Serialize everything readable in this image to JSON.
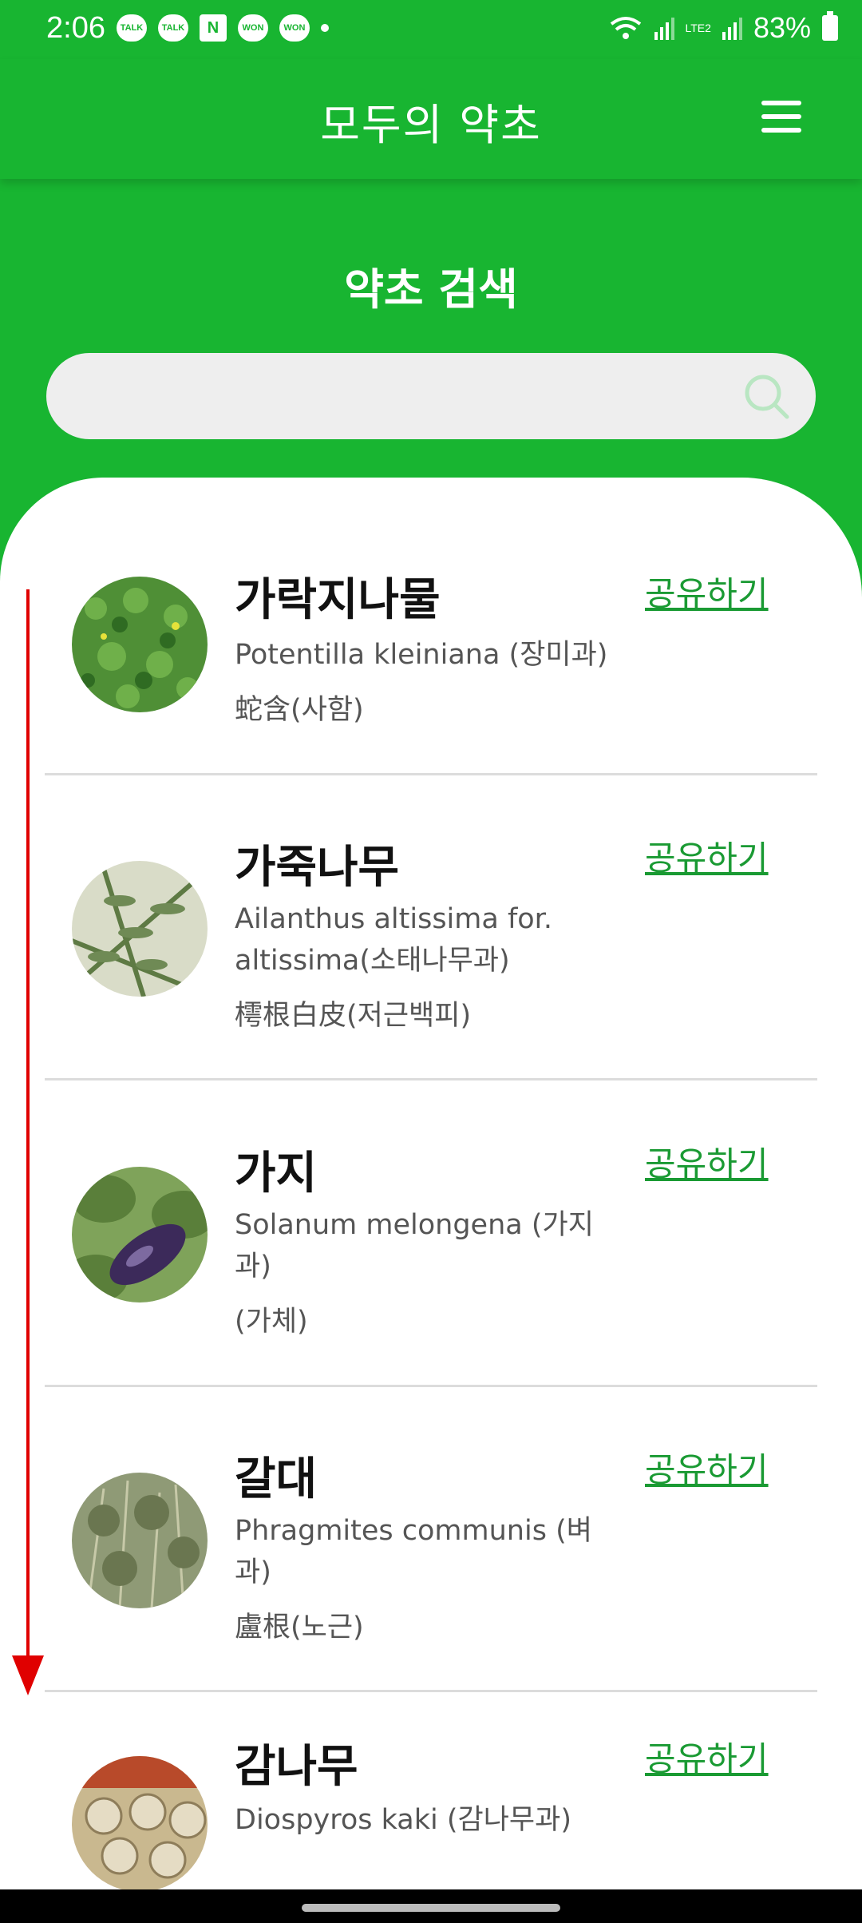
{
  "status": {
    "time": "2:06",
    "notifications": [
      "TALK",
      "TALK",
      "N",
      "WON",
      "WON"
    ],
    "battery": "83%",
    "network": "LTE2"
  },
  "appbar": {
    "title": "모두의 약초",
    "menu_icon": "hamburger-menu-icon"
  },
  "search": {
    "title": "약초 검색",
    "placeholder": "",
    "value": "",
    "icon": "search-icon"
  },
  "items": [
    {
      "name": "가락지나물",
      "scientific": "Potentilla kleiniana (장미과)",
      "herbal": "蛇含(사함)",
      "share": "공유하기",
      "thumb_color": "#4f8f36"
    },
    {
      "name": "가죽나무",
      "scientific": "Ailanthus altissima for. altissima(소태나무과)",
      "herbal": "樗根白皮(저근백피)",
      "share": "공유하기",
      "thumb_color": "#6f8a55"
    },
    {
      "name": "가지",
      "scientific": "Solanum melongena (가지과)",
      "herbal": "(가체)",
      "share": "공유하기",
      "thumb_color": "#3c2a5a"
    },
    {
      "name": "갈대",
      "scientific": "Phragmites communis (벼과)",
      "herbal": "盧根(노근)",
      "share": "공유하기",
      "thumb_color": "#7d8a64"
    },
    {
      "name": "감나무",
      "scientific": "Diospyros kaki (감나무과)",
      "herbal": "",
      "share": "공유하기",
      "thumb_color": "#b8a887"
    }
  ],
  "colors": {
    "primary": "#18b531",
    "share": "#1a9a33",
    "arrow": "#e00000"
  }
}
